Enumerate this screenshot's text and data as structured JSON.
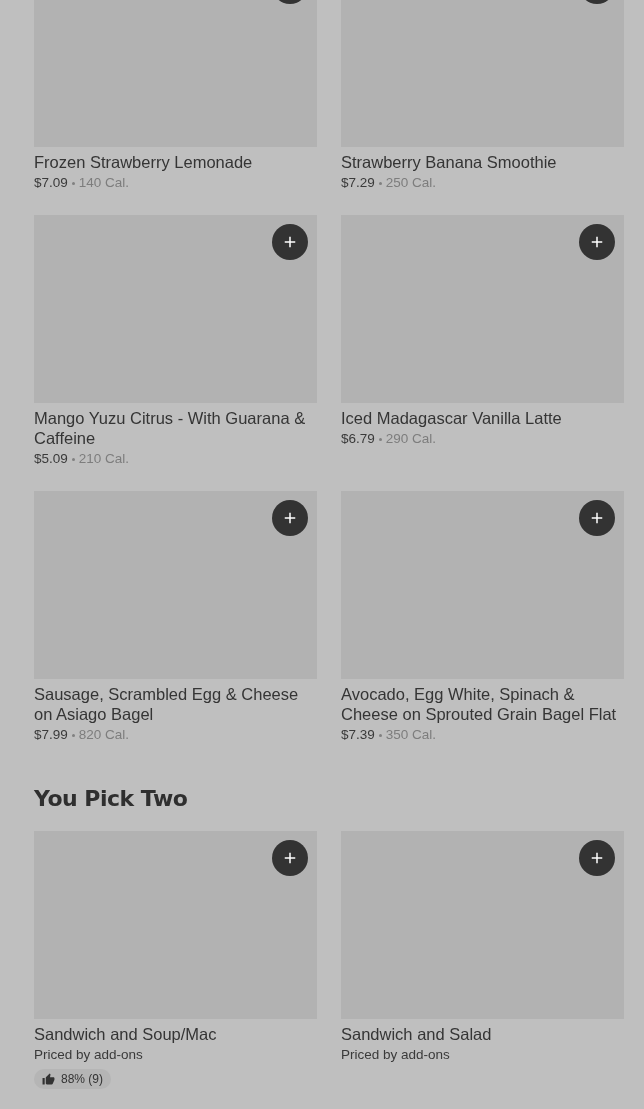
{
  "sections": [
    {
      "items": [
        {
          "name": "Frozen Strawberry Lemonade",
          "price": "$7.09",
          "calories": "140 Cal."
        },
        {
          "name": "Strawberry Banana Smoothie",
          "price": "$7.29",
          "calories": "250 Cal."
        },
        {
          "name": "Mango Yuzu Citrus - With Guarana & Caffeine",
          "price": "$5.09",
          "calories": "210 Cal."
        },
        {
          "name": "Iced Madagascar Vanilla Latte",
          "price": "$6.79",
          "calories": "290 Cal."
        },
        {
          "name": "Sausage, Scrambled Egg & Cheese on Asiago Bagel",
          "price": "$7.99",
          "calories": "820 Cal."
        },
        {
          "name": "Avocado, Egg White, Spinach & Cheese on Sprouted Grain Bagel Flat",
          "price": "$7.39",
          "calories": "350 Cal."
        }
      ]
    },
    {
      "title": "You Pick Two",
      "items": [
        {
          "name": "Sandwich and Soup/Mac",
          "price": "Priced by add-ons",
          "rating": "88% (9)"
        },
        {
          "name": "Sandwich and Salad",
          "price": "Priced by add-ons"
        }
      ]
    }
  ]
}
